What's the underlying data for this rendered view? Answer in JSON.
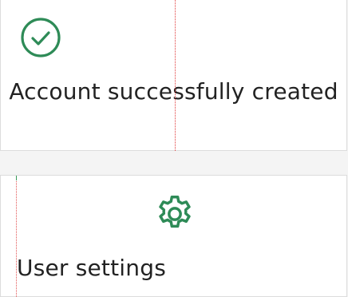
{
  "success_card": {
    "message": "Account successfully created",
    "icon": "check-circle-icon"
  },
  "settings_card": {
    "label": "User settings",
    "icon": "gear-icon"
  },
  "colors": {
    "accent_green": "#2e8b57",
    "text": "#222222",
    "card_border": "#dcdcdc",
    "guide_red": "#e03a3a"
  }
}
